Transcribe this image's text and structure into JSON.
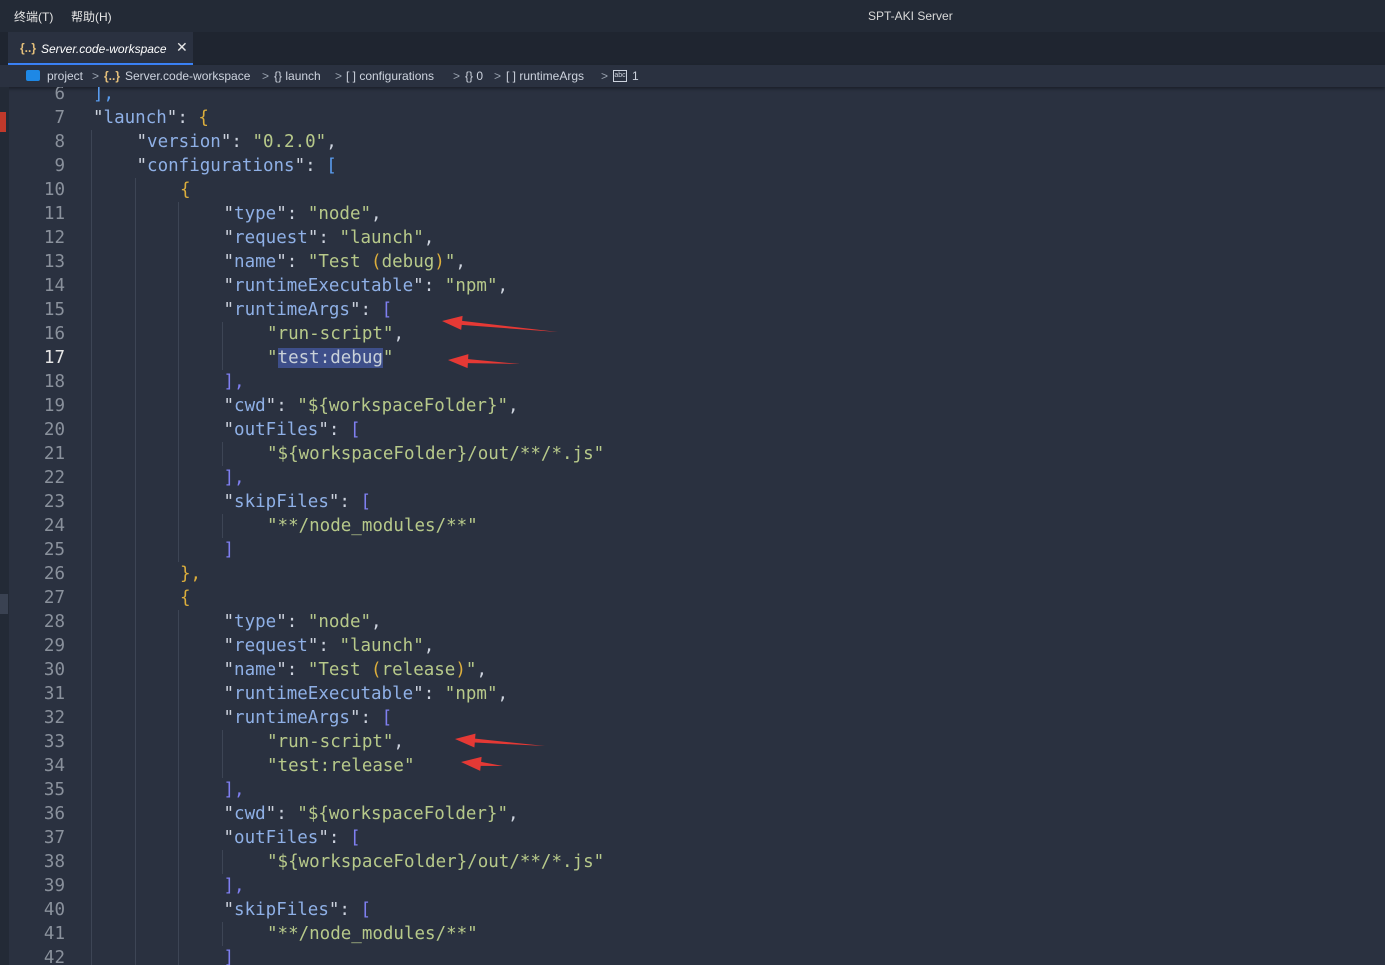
{
  "titlebar": {
    "menu": [
      "终端(T)",
      "帮助(H)"
    ],
    "title": "SPT-AKI Server"
  },
  "tab": {
    "icon": "{..}",
    "label": "Server.code-workspace",
    "close": "✕"
  },
  "breadcrumb": {
    "items": [
      "project",
      "Server.code-workspace",
      "{} launch",
      "[ ] configurations",
      "{} 0",
      "[ ] runtimeArgs",
      "1"
    ],
    "sep": ">"
  },
  "editor": {
    "active_line": 17,
    "lines": [
      {
        "n": "6",
        "indent": 1,
        "parts": [
          [
            "],",
            "br2"
          ]
        ]
      },
      {
        "n": "7",
        "indent": 1,
        "parts": [
          [
            "\"",
            "q"
          ],
          [
            "launch",
            "k"
          ],
          [
            "\"",
            "q"
          ],
          [
            ": ",
            "p"
          ],
          [
            "{",
            "br1"
          ]
        ]
      },
      {
        "n": "8",
        "indent": 2,
        "parts": [
          [
            "\"",
            "q"
          ],
          [
            "version",
            "k"
          ],
          [
            "\"",
            "q"
          ],
          [
            ": ",
            "p"
          ],
          [
            "\"0.2.0\"",
            "s"
          ],
          [
            ",",
            "p"
          ]
        ]
      },
      {
        "n": "9",
        "indent": 2,
        "parts": [
          [
            "\"",
            "q"
          ],
          [
            "configurations",
            "k"
          ],
          [
            "\"",
            "q"
          ],
          [
            ": ",
            "p"
          ],
          [
            "[",
            "br2"
          ]
        ]
      },
      {
        "n": "10",
        "indent": 3,
        "parts": [
          [
            "{",
            "br1"
          ]
        ]
      },
      {
        "n": "11",
        "indent": 4,
        "parts": [
          [
            "\"",
            "q"
          ],
          [
            "type",
            "k"
          ],
          [
            "\"",
            "q"
          ],
          [
            ": ",
            "p"
          ],
          [
            "\"node\"",
            "s"
          ],
          [
            ",",
            "p"
          ]
        ]
      },
      {
        "n": "12",
        "indent": 4,
        "parts": [
          [
            "\"",
            "q"
          ],
          [
            "request",
            "k"
          ],
          [
            "\"",
            "q"
          ],
          [
            ": ",
            "p"
          ],
          [
            "\"launch\"",
            "s"
          ],
          [
            ",",
            "p"
          ]
        ]
      },
      {
        "n": "13",
        "indent": 4,
        "parts": [
          [
            "\"",
            "q"
          ],
          [
            "name",
            "k"
          ],
          [
            "\"",
            "q"
          ],
          [
            ": ",
            "p"
          ],
          [
            "\"Test ",
            "s"
          ],
          [
            "(",
            "br1"
          ],
          [
            "debug",
            "s"
          ],
          [
            ")",
            "br1"
          ],
          [
            "\"",
            "s"
          ],
          [
            ",",
            "p"
          ]
        ]
      },
      {
        "n": "14",
        "indent": 4,
        "parts": [
          [
            "\"",
            "q"
          ],
          [
            "runtimeExecutable",
            "k"
          ],
          [
            "\"",
            "q"
          ],
          [
            ": ",
            "p"
          ],
          [
            "\"npm\"",
            "s"
          ],
          [
            ",",
            "p"
          ]
        ]
      },
      {
        "n": "15",
        "indent": 4,
        "parts": [
          [
            "\"",
            "q"
          ],
          [
            "runtimeArgs",
            "k"
          ],
          [
            "\"",
            "q"
          ],
          [
            ": ",
            "p"
          ],
          [
            "[",
            "br3"
          ]
        ]
      },
      {
        "n": "16",
        "indent": 5,
        "parts": [
          [
            "\"run-script\"",
            "s"
          ],
          [
            ",",
            "p"
          ]
        ]
      },
      {
        "n": "17",
        "indent": 5,
        "parts": [
          [
            "\"",
            "s"
          ],
          [
            "test:debug",
            "sel"
          ],
          [
            "\"",
            "s"
          ]
        ]
      },
      {
        "n": "18",
        "indent": 4,
        "parts": [
          [
            "],",
            "br3"
          ]
        ]
      },
      {
        "n": "19",
        "indent": 4,
        "parts": [
          [
            "\"",
            "q"
          ],
          [
            "cwd",
            "k"
          ],
          [
            "\"",
            "q"
          ],
          [
            ": ",
            "p"
          ],
          [
            "\"${",
            "s"
          ],
          [
            "workspaceFolder",
            "s"
          ],
          [
            "}\"",
            "s"
          ],
          [
            ",",
            "p"
          ]
        ]
      },
      {
        "n": "20",
        "indent": 4,
        "parts": [
          [
            "\"",
            "q"
          ],
          [
            "outFiles",
            "k"
          ],
          [
            "\"",
            "q"
          ],
          [
            ": ",
            "p"
          ],
          [
            "[",
            "br3"
          ]
        ]
      },
      {
        "n": "21",
        "indent": 5,
        "parts": [
          [
            "\"${workspaceFolder}/out/**/*.js\"",
            "s"
          ]
        ]
      },
      {
        "n": "22",
        "indent": 4,
        "parts": [
          [
            "],",
            "br3"
          ]
        ]
      },
      {
        "n": "23",
        "indent": 4,
        "parts": [
          [
            "\"",
            "q"
          ],
          [
            "skipFiles",
            "k"
          ],
          [
            "\"",
            "q"
          ],
          [
            ": ",
            "p"
          ],
          [
            "[",
            "br3"
          ]
        ]
      },
      {
        "n": "24",
        "indent": 5,
        "parts": [
          [
            "\"**/node_modules/**\"",
            "s"
          ]
        ]
      },
      {
        "n": "25",
        "indent": 4,
        "parts": [
          [
            "]",
            "br3"
          ]
        ]
      },
      {
        "n": "26",
        "indent": 3,
        "parts": [
          [
            "},",
            "br1"
          ]
        ]
      },
      {
        "n": "27",
        "indent": 3,
        "parts": [
          [
            "{",
            "br1"
          ]
        ]
      },
      {
        "n": "28",
        "indent": 4,
        "parts": [
          [
            "\"",
            "q"
          ],
          [
            "type",
            "k"
          ],
          [
            "\"",
            "q"
          ],
          [
            ": ",
            "p"
          ],
          [
            "\"node\"",
            "s"
          ],
          [
            ",",
            "p"
          ]
        ]
      },
      {
        "n": "29",
        "indent": 4,
        "parts": [
          [
            "\"",
            "q"
          ],
          [
            "request",
            "k"
          ],
          [
            "\"",
            "q"
          ],
          [
            ": ",
            "p"
          ],
          [
            "\"launch\"",
            "s"
          ],
          [
            ",",
            "p"
          ]
        ]
      },
      {
        "n": "30",
        "indent": 4,
        "parts": [
          [
            "\"",
            "q"
          ],
          [
            "name",
            "k"
          ],
          [
            "\"",
            "q"
          ],
          [
            ": ",
            "p"
          ],
          [
            "\"Test ",
            "s"
          ],
          [
            "(",
            "br1"
          ],
          [
            "release",
            "s"
          ],
          [
            ")",
            "br1"
          ],
          [
            "\"",
            "s"
          ],
          [
            ",",
            "p"
          ]
        ]
      },
      {
        "n": "31",
        "indent": 4,
        "parts": [
          [
            "\"",
            "q"
          ],
          [
            "runtimeExecutable",
            "k"
          ],
          [
            "\"",
            "q"
          ],
          [
            ": ",
            "p"
          ],
          [
            "\"npm\"",
            "s"
          ],
          [
            ",",
            "p"
          ]
        ]
      },
      {
        "n": "32",
        "indent": 4,
        "parts": [
          [
            "\"",
            "q"
          ],
          [
            "runtimeArgs",
            "k"
          ],
          [
            "\"",
            "q"
          ],
          [
            ": ",
            "p"
          ],
          [
            "[",
            "br3"
          ]
        ]
      },
      {
        "n": "33",
        "indent": 5,
        "parts": [
          [
            "\"run-script\"",
            "s"
          ],
          [
            ",",
            "p"
          ]
        ]
      },
      {
        "n": "34",
        "indent": 5,
        "parts": [
          [
            "\"test:release\"",
            "s"
          ]
        ]
      },
      {
        "n": "35",
        "indent": 4,
        "parts": [
          [
            "],",
            "br3"
          ]
        ]
      },
      {
        "n": "36",
        "indent": 4,
        "parts": [
          [
            "\"",
            "q"
          ],
          [
            "cwd",
            "k"
          ],
          [
            "\"",
            "q"
          ],
          [
            ": ",
            "p"
          ],
          [
            "\"${workspaceFolder}\"",
            "s"
          ],
          [
            ",",
            "p"
          ]
        ]
      },
      {
        "n": "37",
        "indent": 4,
        "parts": [
          [
            "\"",
            "q"
          ],
          [
            "outFiles",
            "k"
          ],
          [
            "\"",
            "q"
          ],
          [
            ": ",
            "p"
          ],
          [
            "[",
            "br3"
          ]
        ]
      },
      {
        "n": "38",
        "indent": 5,
        "parts": [
          [
            "\"${workspaceFolder}/out/**/*.js\"",
            "s"
          ]
        ]
      },
      {
        "n": "39",
        "indent": 4,
        "parts": [
          [
            "],",
            "br3"
          ]
        ]
      },
      {
        "n": "40",
        "indent": 4,
        "parts": [
          [
            "\"",
            "q"
          ],
          [
            "skipFiles",
            "k"
          ],
          [
            "\"",
            "q"
          ],
          [
            ": ",
            "p"
          ],
          [
            "[",
            "br3"
          ]
        ]
      },
      {
        "n": "41",
        "indent": 5,
        "parts": [
          [
            "\"**/node_modules/**\"",
            "s"
          ]
        ]
      },
      {
        "n": "42",
        "indent": 4,
        "parts": [
          [
            "]",
            "br3"
          ]
        ]
      }
    ]
  },
  "annotations": {
    "color": "#e53935",
    "arrows": [
      "arrow-line-16",
      "arrow-line-17",
      "arrow-line-33",
      "arrow-line-34"
    ]
  }
}
